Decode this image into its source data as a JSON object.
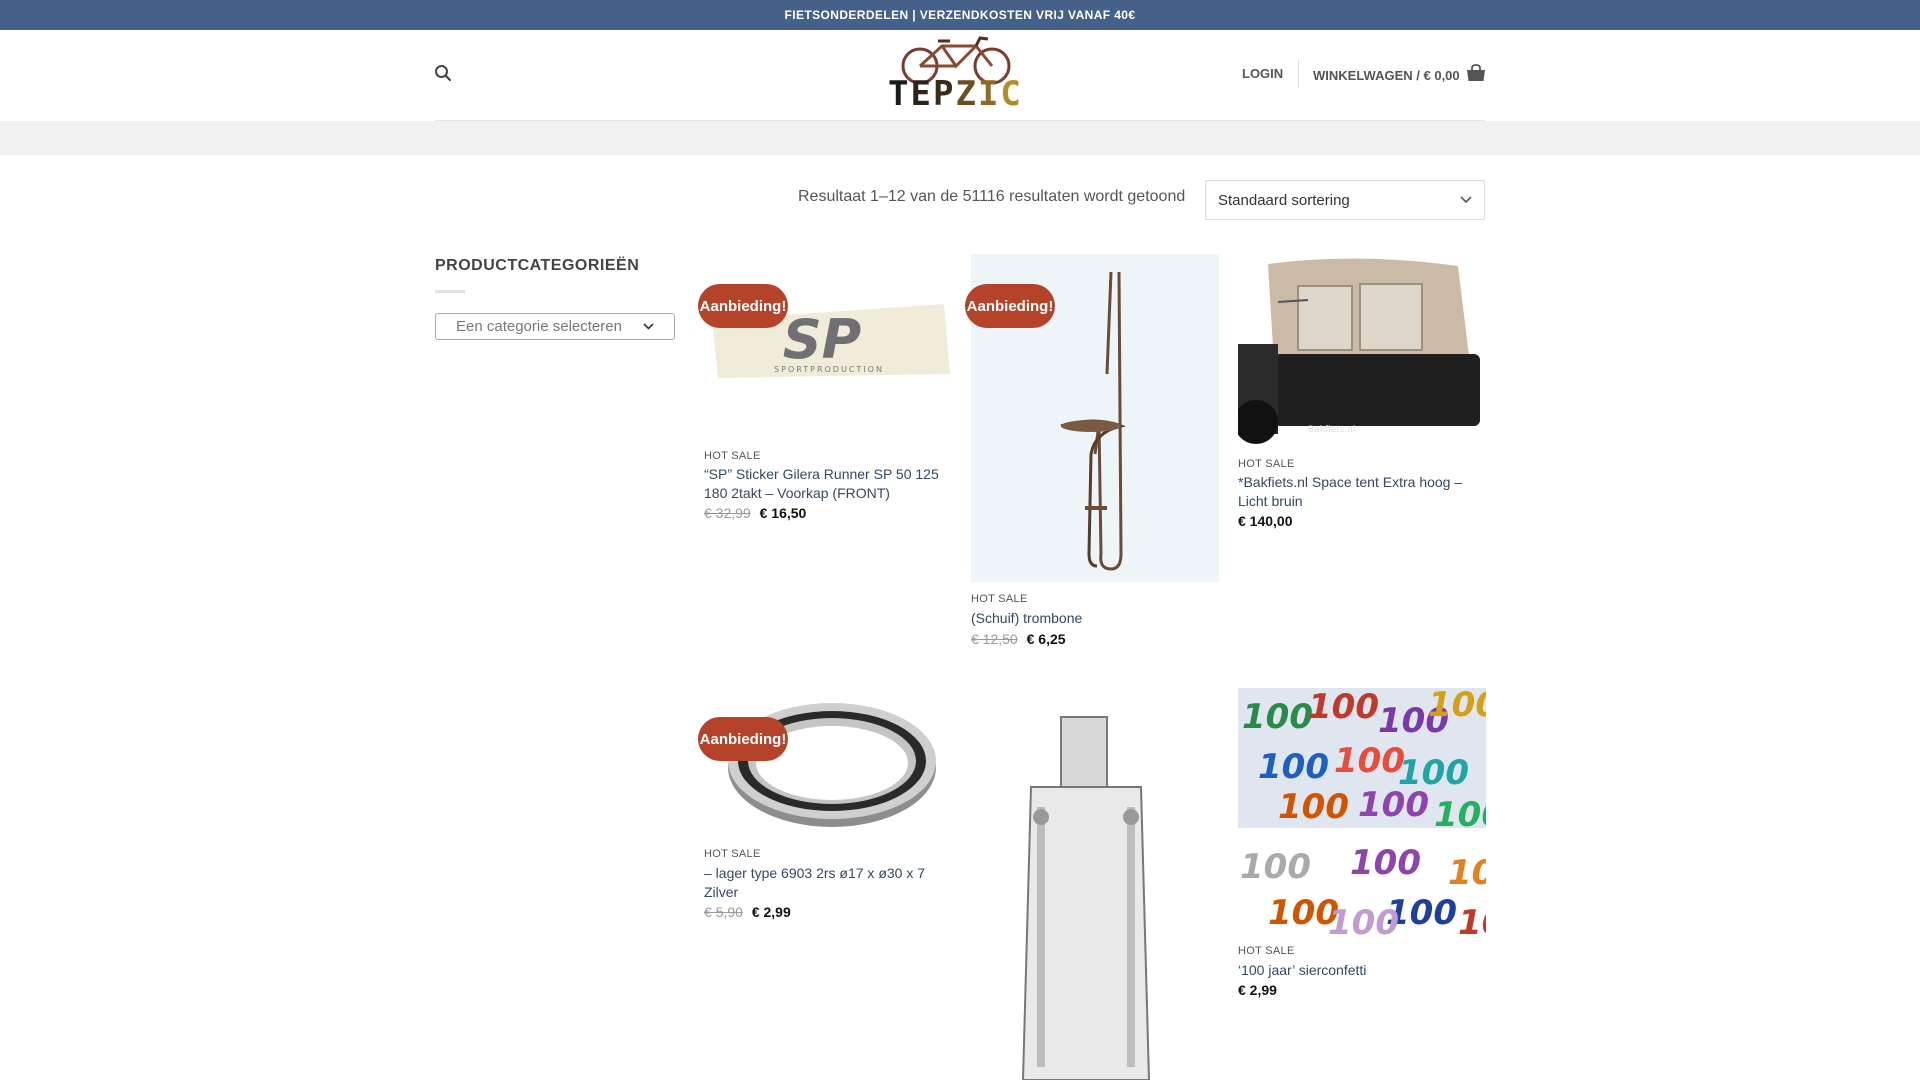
{
  "topbar": {
    "text": "FIETSONDERDELEN | VERZENDKOSTEN VRIJ VANAF 40€"
  },
  "header": {
    "logo_text": "TEPZIC",
    "login_label": "LOGIN",
    "cart_label": "WINKELWAGEN / € 0,00"
  },
  "shop": {
    "result_count": "Resultaat 1–12 van de 51116 resultaten wordt getoond",
    "sort_selected": "Standaard sortering"
  },
  "sidebar": {
    "title": "PRODUCTCATEGORIEËN",
    "category_placeholder": "Een categorie selecteren"
  },
  "products": [
    {
      "badge": "Aanbieding!",
      "category": "HOT SALE",
      "title": "“SP” Sticker Gilera Runner SP 50 125 180 2takt – Voorkap (FRONT)",
      "old_price": "€ 32,99",
      "price": "€ 16,50"
    },
    {
      "badge": "Aanbieding!",
      "category": "HOT SALE",
      "title": "(Schuif) trombone",
      "old_price": "€ 12,50",
      "price": "€ 6,25"
    },
    {
      "badge": "",
      "category": "HOT SALE",
      "title": "*Bakfiets.nl Space tent Extra hoog – Licht bruin",
      "old_price": "",
      "price": "€ 140,00"
    },
    {
      "badge": "Aanbieding!",
      "category": "HOT SALE",
      "title": "– lager type 6903 2rs ø17 x ø30 x 7 Zilver",
      "old_price": "€ 5,90",
      "price": "€ 2,99"
    },
    {
      "badge": "",
      "category": "",
      "title": "",
      "old_price": "",
      "price": ""
    },
    {
      "badge": "",
      "category": "HOT SALE",
      "title": "‘100 jaar’ sierconfetti",
      "old_price": "",
      "price": "€ 2,99"
    }
  ]
}
